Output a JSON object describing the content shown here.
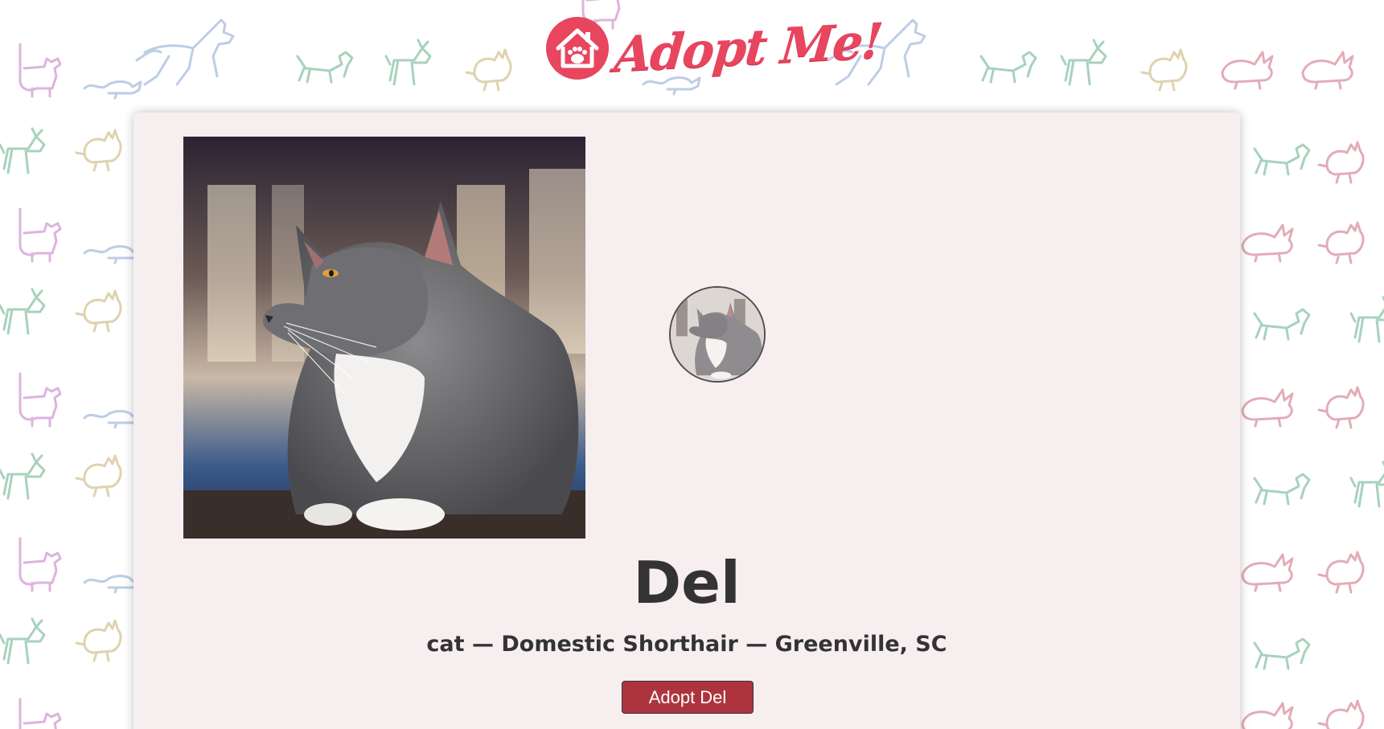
{
  "header": {
    "logo_text": "Adopt Me!",
    "logo_alt": "Adopt Me! logo",
    "brand_color": "#e8455f"
  },
  "details": {
    "hero_image_alt": "animal hero",
    "thumbnail_alt": "animal thumbnail",
    "name": "Del",
    "animal": "cat",
    "breed": "Domestic Shorthair",
    "location": "Greenville, SC",
    "meta_line": "cat — Domestic Shorthair — Greenville, SC",
    "adopt_button_label": "Adopt Del",
    "button_color": "#ad343e",
    "card_color": "#f7eef0"
  }
}
